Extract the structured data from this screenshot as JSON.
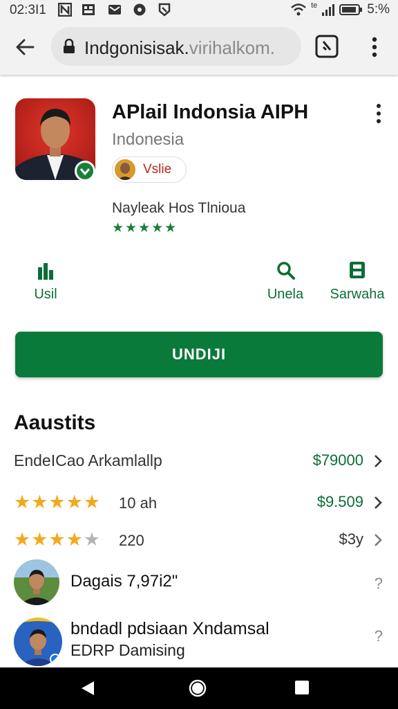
{
  "status": {
    "time": "02:3I1",
    "battery": "5:%",
    "signal_badge": "te"
  },
  "browser": {
    "url_main": "Indgonisisak.",
    "url_dim": "virihalkom."
  },
  "app": {
    "title": "APlail Indonsia AIPH",
    "developer": "Indonesia",
    "chip_label": "Vslie",
    "review_caption": "Nayleak Hos Tlnioua",
    "rating_stars": "★★★★★"
  },
  "actions": [
    {
      "label": "Usil",
      "icon": "chart-icon"
    },
    {
      "label": "Unela",
      "icon": "search-icon"
    },
    {
      "label": "Sarwaha",
      "icon": "save-icon"
    }
  ],
  "install_label": "UNDIJI",
  "section": {
    "title": "Aaustits",
    "rows": [
      {
        "text": "EndeICao Arkamlallp",
        "value": "$79000",
        "value_color": "#0b6e37"
      },
      {
        "stars_on": 5,
        "stars_off": 0,
        "count": "10 ah",
        "value": "$9.509",
        "value_color": "#0b6e37"
      },
      {
        "stars_on": 4,
        "stars_off": 1,
        "count": "220",
        "value": "$3y",
        "value_color": "#333333"
      }
    ],
    "list": [
      {
        "name": "Dagais 7,97i2\"",
        "aside": "?"
      },
      {
        "name": "bndadl pdsiaan Xndamsal",
        "sub": "EDRP Damising",
        "aside": "?"
      }
    ]
  },
  "colors": {
    "accent": "#0a7a3a",
    "star": "#f4a81d",
    "price": "#0b6e37"
  }
}
